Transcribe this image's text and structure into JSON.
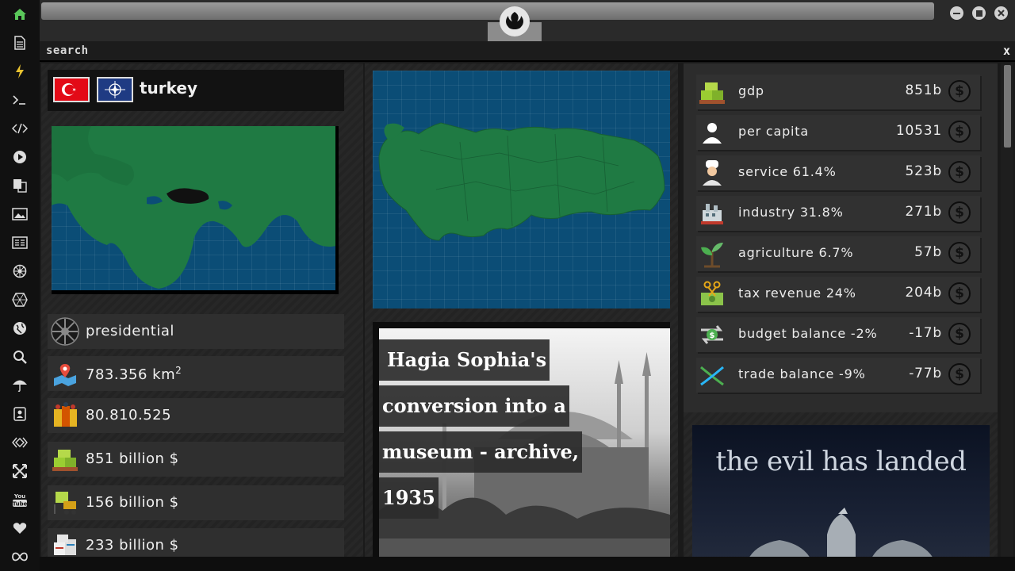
{
  "window": {
    "search_label": "search",
    "close_label": "x"
  },
  "rail_icons": [
    "home-icon",
    "document-icon",
    "lightning-icon",
    "terminal-icon",
    "code-icon",
    "play-icon",
    "translate-icon",
    "image-icon",
    "newspaper-icon",
    "rebel-icon",
    "hexagon-icon",
    "globe-icon",
    "search-icon",
    "umbrella-icon",
    "contact-icon",
    "diamond-icon",
    "shuffle-icon",
    "youtube-icon",
    "heart-icon",
    "infinity-icon"
  ],
  "country": {
    "name": "turkey",
    "government": "presidential",
    "area": "783.356 km",
    "area_unit_sup": "2",
    "population": "80.810.525",
    "gdp": "851 billion $",
    "row5": "156 billion $",
    "row6": "233 billion $"
  },
  "news": {
    "lines": [
      "Hagia Sophia's",
      "conversion into a",
      "museum - archive,",
      "1935"
    ]
  },
  "stats": [
    {
      "label": "gdp",
      "value": "851b"
    },
    {
      "label": "per capita",
      "value": "10531"
    },
    {
      "label": "service 61.4%",
      "value": "523b"
    },
    {
      "label": "industry 31.8%",
      "value": "271b"
    },
    {
      "label": "agriculture 6.7%",
      "value": "57b"
    },
    {
      "label": "tax revenue 24%",
      "value": "204b"
    },
    {
      "label": "budget balance -2%",
      "value": "-17b"
    },
    {
      "label": "trade balance -9%",
      "value": "-77b"
    }
  ],
  "currency_symbol": "$",
  "promo": {
    "title": "the evil has landed"
  },
  "colors": {
    "accent_green": "#5ac85a",
    "map_land": "#1f7a43",
    "map_sea": "#0b4d76",
    "turkey_highlight": "#111111"
  }
}
